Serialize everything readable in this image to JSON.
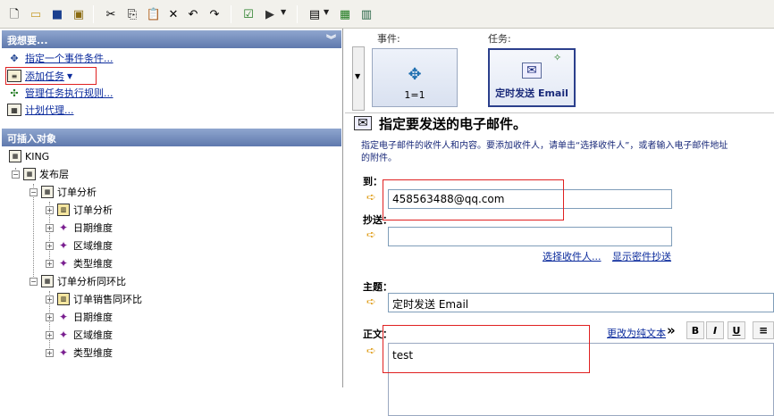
{
  "toolbar": {
    "icons": [
      "new-icon",
      "open-icon",
      "save-icon",
      "save-all-icon",
      "cut-icon",
      "copy-icon",
      "paste-icon",
      "delete-icon",
      "undo-icon",
      "redo-icon",
      "validate-icon",
      "run-icon",
      "properties-icon",
      "excel-icon",
      "report-icon"
    ]
  },
  "left_panel": {
    "wizard_section": {
      "title": "我想要...",
      "links": [
        "指定一个事件条件...",
        "添加任务",
        "管理任务执行规则...",
        "计划代理..."
      ]
    },
    "insertable_section": {
      "title": "可插入对象",
      "tree": [
        {
          "label": "KING"
        },
        {
          "label": "发布层"
        },
        {
          "label": "订单分析"
        },
        {
          "label": "订单分析"
        },
        {
          "label": "日期维度"
        },
        {
          "label": "区域维度"
        },
        {
          "label": "类型维度"
        },
        {
          "label": "订单分析同环比"
        },
        {
          "label": "订单销售同环比"
        },
        {
          "label": "日期维度"
        },
        {
          "label": "区域维度"
        },
        {
          "label": "类型维度"
        }
      ]
    }
  },
  "right_panel": {
    "event_caption": "事件:",
    "task_caption": "任务:",
    "event_card_label": "1=1",
    "task_card_label": "定时发送 Email",
    "heading": "指定要发送的电子邮件。",
    "description_line1": "指定电子邮件的收件人和内容。要添加收件人，请单击“选择收件人”，或者输入电子邮件地址",
    "description_line2": "的附件。",
    "to_label": "到：",
    "to_value": "458563488@qq.com",
    "cc_label": "抄送：",
    "cc_value": "",
    "select_recipients_link": "选择收件人...",
    "show_bcc_link": "显示密件抄送",
    "subject_label": "主题：",
    "subject_value": "定时发送 Email",
    "body_label": "正文：",
    "plain_text_link": "更改为纯文本",
    "chevron_text": "»",
    "format_buttons": [
      "B",
      "I",
      "U"
    ],
    "body_value": "test"
  }
}
